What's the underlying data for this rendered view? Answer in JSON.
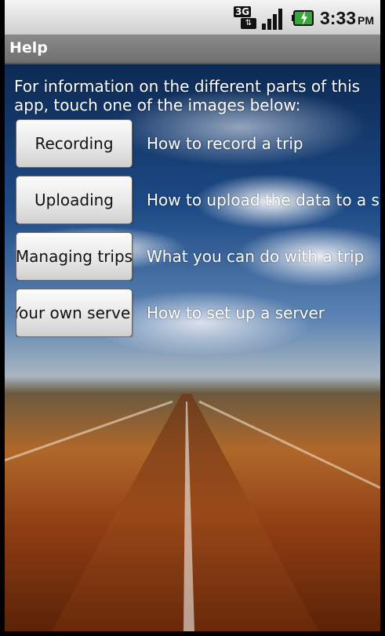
{
  "status_bar": {
    "network": "3G",
    "clock": "3:33",
    "ampm": "PM",
    "icons": [
      "network-3g-icon",
      "signal-strength-icon",
      "battery-charging-icon"
    ]
  },
  "title_bar": {
    "title": "Help"
  },
  "intro_text": "For information on the different parts of this app, touch one of the images below:",
  "help_items": [
    {
      "button": "Recording",
      "description": "How to record a trip"
    },
    {
      "button": "Uploading",
      "description": "How to upload the data to a ser"
    },
    {
      "button": "Managing trips",
      "description": "What you can do with a trip"
    },
    {
      "button": "Your own server",
      "description": "How to set up a server"
    }
  ],
  "colors": {
    "title_bar": "#7d7d7d",
    "status_bar": "#e0e0e0",
    "button": "#eeeeee"
  }
}
